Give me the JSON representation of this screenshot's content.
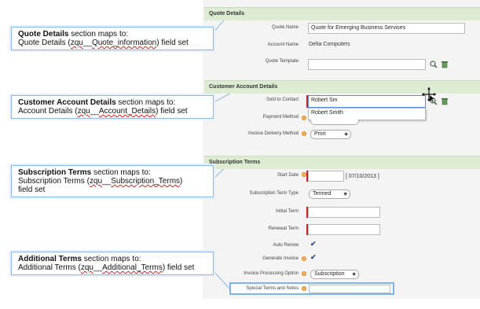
{
  "sections": {
    "quote_details": "Quote Details",
    "customer_account": "Customer Account Details",
    "subscription_terms": "Subscription Terms"
  },
  "fields": {
    "quote_name_label": "Quote Name",
    "quote_name_value": "Quote for Emerging Business Services",
    "account_name_label": "Account Name",
    "account_name_value": "Delta Computers",
    "quote_template_label": "Quote Template",
    "quote_template_value": "",
    "sold_to_label": "Sold to Contact",
    "sold_to_value": "Robert Sm",
    "sold_to_suggestion": "Robert Smith",
    "payment_method_label": "Payment Method",
    "invoice_delivery_label": "Invoice Delivery Method",
    "invoice_delivery_value": "Print",
    "start_date_label": "Start Date",
    "start_date_value": "",
    "start_date_hint": "[ 07/10/2013 ]",
    "sub_term_type_label": "Subscription Term Type",
    "sub_term_type_value": "Termed",
    "initial_term_label": "Initial Term",
    "initial_term_value": "",
    "renewal_term_label": "Renewal Term",
    "renewal_term_value": "",
    "auto_renew_label": "Auto Renew",
    "auto_renew_checked": true,
    "generate_invoice_label": "Generate Invoice",
    "generate_invoice_checked": true,
    "invoice_processing_label": "Invoice Processing Option",
    "invoice_processing_value": "Subscription",
    "special_terms_label": "Special Terms and Notes",
    "special_terms_value": ""
  },
  "callouts": {
    "c1_bold": "Quote Details",
    "c1_rest": " section maps to:",
    "c1_line2a": "Quote Details (",
    "c1_line2b": "zqu",
    "c1_line2c": "__",
    "c1_line2d": "Quote_information",
    "c1_line2e": ") field set",
    "c2_bold": "Customer Account Details",
    "c2_rest": " section maps to:",
    "c2_line2a": "Account Details (",
    "c2_line2b": "zqu",
    "c2_line2c": "__",
    "c2_line2d": "Account_Details",
    "c2_line2e": ") field set",
    "c3_bold": "Subscription Terms",
    "c3_rest": " section maps to:",
    "c3_line2a": "Subscription Terms (",
    "c3_line2b": "zqu",
    "c3_line2c": "__",
    "c3_line2d": "Subscription_Terms",
    "c3_line2e": ")",
    "c3_line3": "field set",
    "c4_bold": "Additional Terms",
    "c4_rest": " section maps to:",
    "c4_line2a": "Additional Terms (",
    "c4_line2b": "zqu",
    "c4_line2c": "__",
    "c4_line2d": "Additional_Terms",
    "c4_line2e": ") field set"
  },
  "colors": {
    "section_header_bg": "#dcebd2",
    "required_bar": "#cc2222",
    "callout_border": "#8fb9e3"
  },
  "icons": [
    "lookup-icon",
    "delete-icon",
    "help-icon",
    "checkmark-icon",
    "move-cursor-icon"
  ]
}
